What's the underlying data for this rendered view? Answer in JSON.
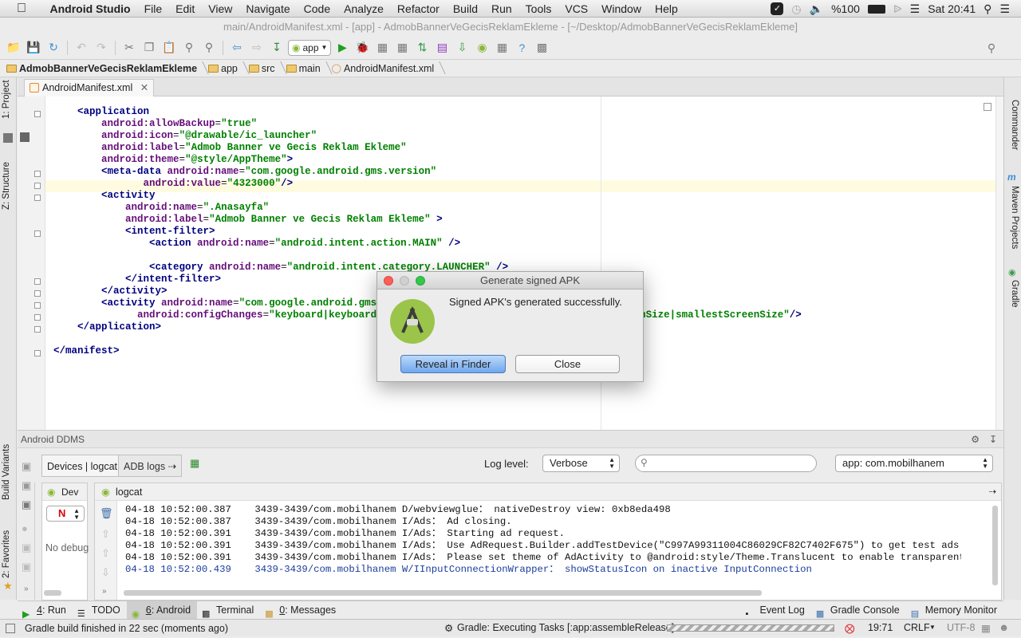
{
  "menubar": {
    "app_name": "Android Studio",
    "items": [
      "File",
      "Edit",
      "View",
      "Navigate",
      "Code",
      "Analyze",
      "Refactor",
      "Build",
      "Run",
      "Tools",
      "VCS",
      "Window",
      "Help"
    ],
    "battery": "%100",
    "clock": "Sat 20:41"
  },
  "window_title": "main/AndroidManifest.xml - [app] - AdmobBannerVeGecisReklamEkleme - [~/Desktop/AdmobBannerVeGecisReklamEkleme]",
  "toolbar": {
    "run_config": "app"
  },
  "breadcrumb": [
    "AdmobBannerVeGecisReklamEkleme",
    "app",
    "src",
    "main",
    "AndroidManifest.xml"
  ],
  "left_strip": {
    "project": "1: Project",
    "structure": "Z: Structure",
    "build_variants": "Build Variants",
    "favorites": "2: Favorites"
  },
  "right_strip": {
    "commander": "Commander",
    "maven": "Maven Projects",
    "gradle": "Gradle"
  },
  "editor": {
    "tab": "AndroidManifest.xml",
    "lines": [
      [
        [
          "    ",
          "p"
        ],
        [
          "<application",
          "tg"
        ]
      ],
      [
        [
          "        ",
          "p"
        ],
        [
          "android:",
          "at"
        ],
        [
          "allowBackup",
          "at"
        ],
        [
          "=",
          "p"
        ],
        [
          "\"true\"",
          "vl"
        ]
      ],
      [
        [
          "        ",
          "p"
        ],
        [
          "android:",
          "at"
        ],
        [
          "icon",
          "at"
        ],
        [
          "=",
          "p"
        ],
        [
          "\"@drawable/ic_launcher\"",
          "vl"
        ]
      ],
      [
        [
          "        ",
          "p"
        ],
        [
          "android:",
          "at"
        ],
        [
          "label",
          "at"
        ],
        [
          "=",
          "p"
        ],
        [
          "\"Admob Banner ve Gecis Reklam Ekleme\"",
          "vl"
        ]
      ],
      [
        [
          "        ",
          "p"
        ],
        [
          "android:",
          "at"
        ],
        [
          "theme",
          "at"
        ],
        [
          "=",
          "p"
        ],
        [
          "\"@style/AppTheme\"",
          "vl"
        ],
        [
          ">",
          "tg"
        ]
      ],
      [
        [
          "        ",
          "p"
        ],
        [
          "<meta-data ",
          "tg"
        ],
        [
          "android:",
          "at"
        ],
        [
          "name",
          "at"
        ],
        [
          "=",
          "p"
        ],
        [
          "\"com.google.android.gms.version\"",
          "vl"
        ]
      ],
      [
        [
          "               ",
          "p"
        ],
        [
          "android:",
          "at"
        ],
        [
          "value",
          "at"
        ],
        [
          "=",
          "p"
        ],
        [
          "\"4323000\"",
          "vl"
        ],
        [
          "/>",
          "tg"
        ]
      ],
      [
        [
          "        ",
          "p"
        ],
        [
          "<activity",
          "tg"
        ]
      ],
      [
        [
          "            ",
          "p"
        ],
        [
          "android:",
          "at"
        ],
        [
          "name",
          "at"
        ],
        [
          "=",
          "p"
        ],
        [
          "\".Anasayfa\"",
          "vl"
        ]
      ],
      [
        [
          "            ",
          "p"
        ],
        [
          "android:",
          "at"
        ],
        [
          "label",
          "at"
        ],
        [
          "=",
          "p"
        ],
        [
          "\"Admob Banner ve Gecis Reklam Ekleme\"",
          "vl"
        ],
        [
          " >",
          "tg"
        ]
      ],
      [
        [
          "            ",
          "p"
        ],
        [
          "<intent-filter>",
          "tg"
        ]
      ],
      [
        [
          "                ",
          "p"
        ],
        [
          "<action ",
          "tg"
        ],
        [
          "android:",
          "at"
        ],
        [
          "name",
          "at"
        ],
        [
          "=",
          "p"
        ],
        [
          "\"android.intent.action.MAIN\"",
          "vl"
        ],
        [
          " />",
          "tg"
        ]
      ],
      [
        [
          "",
          "p"
        ]
      ],
      [
        [
          "                ",
          "p"
        ],
        [
          "<category ",
          "tg"
        ],
        [
          "android:",
          "at"
        ],
        [
          "name",
          "at"
        ],
        [
          "=",
          "p"
        ],
        [
          "\"android.intent.category.LAUNCHER\"",
          "vl"
        ],
        [
          " />",
          "tg"
        ]
      ],
      [
        [
          "            ",
          "p"
        ],
        [
          "</intent-filter>",
          "tg"
        ]
      ],
      [
        [
          "        ",
          "p"
        ],
        [
          "</activity>",
          "tg"
        ]
      ],
      [
        [
          "        ",
          "p"
        ],
        [
          "<activity ",
          "tg"
        ],
        [
          "android:",
          "at"
        ],
        [
          "name",
          "at"
        ],
        [
          "=",
          "p"
        ],
        [
          "\"com.google.android.gms.ads.AdActivity\"",
          "vl"
        ]
      ],
      [
        [
          "              ",
          "p"
        ],
        [
          "android:",
          "at"
        ],
        [
          "configChanges",
          "at"
        ],
        [
          "=",
          "p"
        ],
        [
          "\"keyboard|keyboardHidden|orientation|screenLayout|uiMode|screenSize|smallestScreenSize\"",
          "vl"
        ],
        [
          "/>",
          "tg"
        ]
      ],
      [
        [
          "    ",
          "p"
        ],
        [
          "</application>",
          "tg"
        ]
      ],
      [
        [
          "",
          "p"
        ]
      ],
      [
        [
          "</manifest>",
          "tg"
        ]
      ]
    ]
  },
  "ddms": {
    "title": "Android DDMS",
    "tab_devices": "Devices | logcat",
    "tab_adb": "ADB logs",
    "log_level_label": "Log level:",
    "log_level": "Verbose",
    "app_filter": "app: com.mobilhanem",
    "device_tab": "Dev",
    "device_filter": "N",
    "no_debug": "No debug",
    "logcat_title": "logcat",
    "log_lines": [
      {
        "text": "04-18 10:52:00.387    3439-3439/com.mobilhanem D/webviewglue： nativeDestroy view: 0xb8eda498",
        "warn": false
      },
      {
        "text": "04-18 10:52:00.387    3439-3439/com.mobilhanem I/Ads： Ad closing.",
        "warn": false
      },
      {
        "text": "04-18 10:52:00.391    3439-3439/com.mobilhanem I/Ads： Starting ad request.",
        "warn": false
      },
      {
        "text": "04-18 10:52:00.391    3439-3439/com.mobilhanem I/Ads： Use AdRequest.Builder.addTestDevice(\"C997A99311004C86029CF82C7402F675\") to get test ads on this devic",
        "warn": false
      },
      {
        "text": "04-18 10:52:00.391    3439-3439/com.mobilhanem I/Ads： Please set theme of AdActivity to @android:style/Theme.Translucent to enable transparent background i",
        "warn": false
      },
      {
        "text": "04-18 10:52:00.439    3439-3439/com.mobilhanem W/IInputConnectionWrapper： showStatusIcon on inactive InputConnection",
        "warn": true
      }
    ]
  },
  "tool_tabs": [
    {
      "key": "4",
      "label": ": Run"
    },
    {
      "key": "",
      "label": "TODO"
    },
    {
      "key": "6",
      "label": ": Android"
    },
    {
      "key": "",
      "label": "Terminal"
    },
    {
      "key": "0",
      "label": ": Messages"
    }
  ],
  "tool_tabs_right": [
    "Event Log",
    "Gradle Console",
    "Memory Monitor"
  ],
  "status": {
    "message": "Gradle build finished in 22 sec (moments ago)",
    "task": "Gradle: Executing Tasks [:app:assembleRelease]",
    "position": "19:71",
    "line_sep": "CRLF",
    "encoding": "UTF-8"
  },
  "dialog": {
    "title": "Generate signed APK",
    "message": "Signed APK's generated successfully.",
    "reveal_button": "Reveal in Finder",
    "close_button": "Close"
  },
  "colors": {
    "tag": "#000080",
    "attr": "#660e7a",
    "value": "#008000",
    "default_button": "#6fa7ee"
  }
}
